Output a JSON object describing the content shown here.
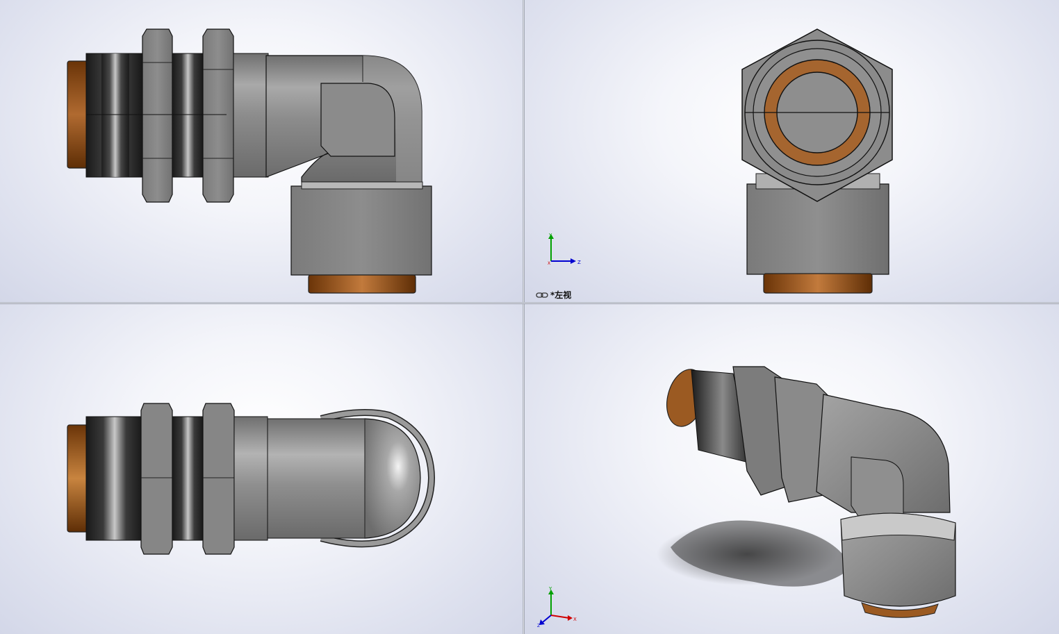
{
  "viewports": {
    "top_right": {
      "view_label": "*左视"
    }
  },
  "triad": {
    "axis_x": "X",
    "axis_y": "Y",
    "axis_z": "Z"
  },
  "icons": {
    "view_link": "link-chain-icon",
    "triad": "coordinate-triad-icon"
  },
  "colors": {
    "steel": "#8a8a8a",
    "brass": "#a0602c",
    "thread_dark": "#1e1e1e",
    "axis_x": "#d00000",
    "axis_y": "#009a00",
    "axis_z": "#0000d0"
  }
}
